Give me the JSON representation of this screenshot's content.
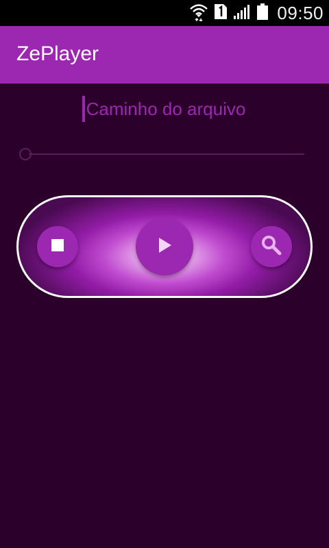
{
  "status_bar": {
    "time": "09:50",
    "icons": [
      "wifi-icon",
      "sim-1-icon",
      "signal-icon",
      "battery-icon"
    ]
  },
  "app_bar": {
    "title": "ZePlayer"
  },
  "path_field": {
    "placeholder": "Caminho do arquivo"
  },
  "seekbar": {
    "progress": 0
  },
  "controls": {
    "stop_icon": "stop-icon",
    "play_icon": "play-icon",
    "search_icon": "search-icon"
  },
  "colors": {
    "accent": "#9c27b0",
    "background": "#2b002b",
    "status_bar": "#000000"
  }
}
